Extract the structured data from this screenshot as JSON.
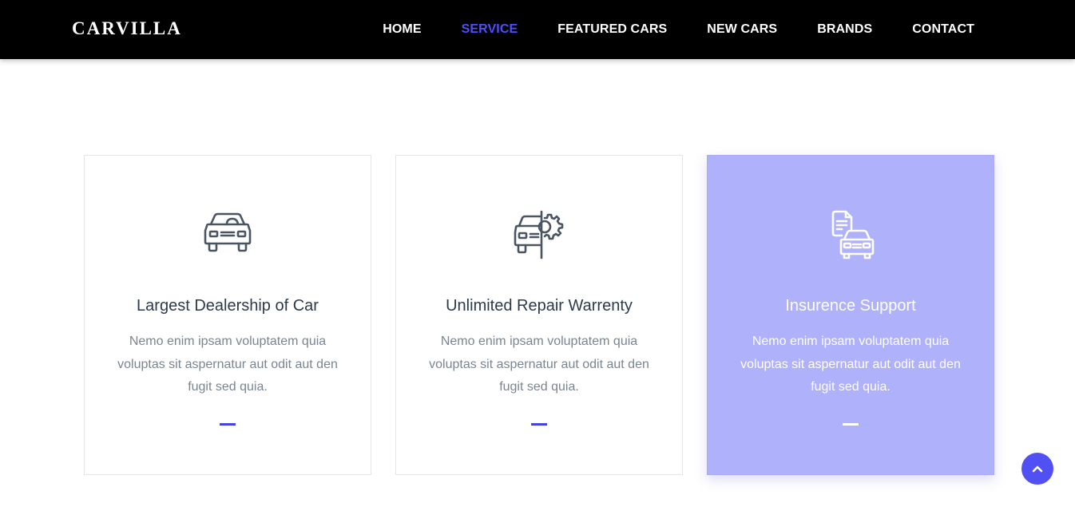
{
  "navbar": {
    "brand": "CARVILLA",
    "links": [
      {
        "label": "HOME",
        "active": false
      },
      {
        "label": "SERVICE",
        "active": true
      },
      {
        "label": "FEATURED CARS",
        "active": false
      },
      {
        "label": "NEW CARS",
        "active": false
      },
      {
        "label": "BRANDS",
        "active": false
      },
      {
        "label": "CONTACT",
        "active": false
      }
    ]
  },
  "services": [
    {
      "icon": "car-icon",
      "title": "Largest Dealership of Car",
      "text": "Nemo enim ipsam voluptatem quia voluptas sit aspernatur aut odit aut den fugit sed quia."
    },
    {
      "icon": "car-repair-icon",
      "title": "Unlimited Repair Warrenty",
      "text": "Nemo enim ipsam voluptatem quia voluptas sit aspernatur aut odit aut den fugit sed quia."
    },
    {
      "icon": "car-insurance-icon",
      "title": "Insurence Support",
      "text": "Nemo enim ipsam voluptatem quia voluptas sit aspernatur aut odit aut den fugit sed quia."
    }
  ],
  "scroll_top": {
    "icon": "chevron-up-icon"
  },
  "colors": {
    "accent": "#4e4ffa",
    "highlight_card": "#b0b1fb",
    "navbar_bg": "#000000"
  }
}
